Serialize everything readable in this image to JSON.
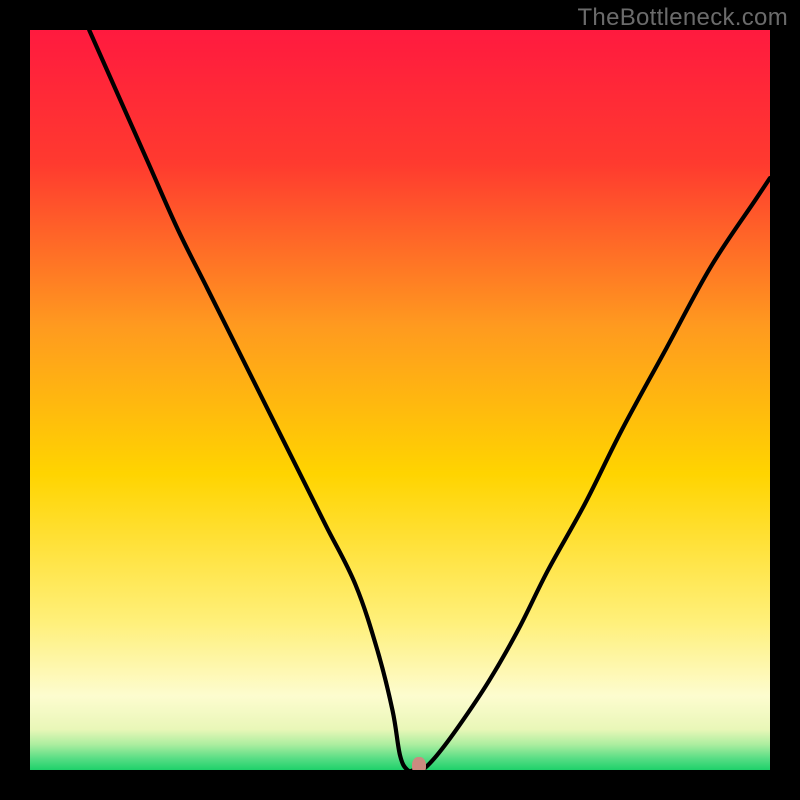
{
  "watermark": {
    "text": "TheBottleneck.com"
  },
  "colors": {
    "top": "#ff1a3f",
    "mid_upper": "#ff7a1f",
    "mid": "#ffd400",
    "mid_lower": "#fff07a",
    "pale": "#fdfccf",
    "green_light": "#8fe89a",
    "green": "#1fd16a",
    "curve": "#000000",
    "marker": "#cb8a80",
    "frame": "#000000"
  },
  "chart_data": {
    "type": "line",
    "title": "",
    "xlabel": "",
    "ylabel": "",
    "xlim": [
      0,
      100
    ],
    "ylim": [
      0,
      100
    ],
    "grid": false,
    "legend": false,
    "series": [
      {
        "name": "bottleneck-curve",
        "x": [
          8,
          12,
          16,
          20,
          24,
          28,
          32,
          36,
          40,
          44,
          47,
          49,
          50,
          51,
          52,
          53,
          55,
          58,
          62,
          66,
          70,
          75,
          80,
          86,
          92,
          98,
          100
        ],
        "y": [
          100,
          91,
          82,
          73,
          65,
          57,
          49,
          41,
          33,
          25,
          16,
          8,
          2,
          0,
          0,
          0,
          2,
          6,
          12,
          19,
          27,
          36,
          46,
          57,
          68,
          77,
          80
        ]
      }
    ],
    "marker": {
      "x": 52.5,
      "y": 0
    },
    "gradient_stops": [
      {
        "offset": 0.0,
        "color": "#ff1a3f"
      },
      {
        "offset": 0.18,
        "color": "#ff3a2f"
      },
      {
        "offset": 0.4,
        "color": "#ff9a1f"
      },
      {
        "offset": 0.6,
        "color": "#ffd400"
      },
      {
        "offset": 0.8,
        "color": "#fff07a"
      },
      {
        "offset": 0.9,
        "color": "#fdfccf"
      },
      {
        "offset": 0.945,
        "color": "#e9f7b8"
      },
      {
        "offset": 0.965,
        "color": "#aeeea0"
      },
      {
        "offset": 0.985,
        "color": "#56dd84"
      },
      {
        "offset": 1.0,
        "color": "#1fd16a"
      }
    ]
  }
}
